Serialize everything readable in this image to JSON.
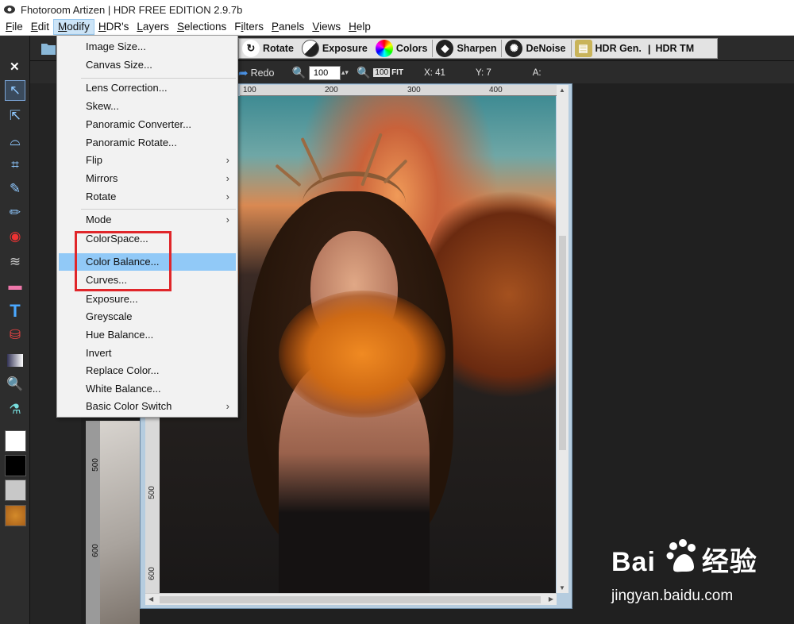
{
  "window": {
    "title": "Fhotoroom Artizen | HDR FREE EDITION 2.9.7b"
  },
  "menubar": {
    "items": [
      {
        "label": "File",
        "u": "F",
        "rest": "ile"
      },
      {
        "label": "Edit",
        "u": "E",
        "rest": "dit"
      },
      {
        "label": "Modify",
        "u": "M",
        "rest": "odify"
      },
      {
        "label": "HDR's",
        "u": "H",
        "rest": "DR's"
      },
      {
        "label": "Layers",
        "u": "L",
        "rest": "ayers"
      },
      {
        "label": "Selections",
        "u": "S",
        "rest": "elections"
      },
      {
        "label": "Filters",
        "u": "i",
        "pre": "F",
        "rest": "lters"
      },
      {
        "label": "Panels",
        "u": "P",
        "rest": "anels"
      },
      {
        "label": "Views",
        "u": "V",
        "rest": "iews"
      },
      {
        "label": "Help",
        "u": "H",
        "rest": "elp"
      }
    ]
  },
  "toolbar1": {
    "rotate": "Rotate",
    "exposure": "Exposure",
    "colors": "Colors",
    "sharpen": "Sharpen",
    "denoise": "DeNoise",
    "hdr_gen": "HDR Gen.",
    "separator": "|",
    "hdr_tm": "HDR TM"
  },
  "toolbar2": {
    "redo": "Redo",
    "zoom": "100",
    "zoom_glyph": "100",
    "fit": "FIT",
    "x": "X: 41",
    "y": "Y: 7",
    "a": "A:"
  },
  "ruler": {
    "h": [
      "100",
      "200",
      "300",
      "400"
    ],
    "v": [
      "500",
      "600"
    ],
    "outer_v": [
      "500",
      "600"
    ]
  },
  "modify_menu": {
    "items": [
      {
        "label": "Image Size...",
        "sub": false
      },
      {
        "label": "Canvas Size...",
        "sub": false
      },
      {
        "label": "Lens Correction...",
        "sub": false
      },
      {
        "label": "Skew...",
        "sub": false
      },
      {
        "label": "Panoramic Converter...",
        "sub": false
      },
      {
        "label": "Panoramic Rotate...",
        "sub": false
      },
      {
        "label": "Flip",
        "sub": true
      },
      {
        "label": "Mirrors",
        "sub": true
      },
      {
        "label": "Rotate",
        "sub": true
      },
      {
        "label": "Mode",
        "sub": true
      },
      {
        "label": "ColorSpace...",
        "sub": false
      },
      {
        "label": "Color Balance...",
        "sub": false,
        "highlighted": true
      },
      {
        "label": "Curves...",
        "sub": false
      },
      {
        "label": "Exposure...",
        "sub": false
      },
      {
        "label": "Greyscale",
        "sub": false
      },
      {
        "label": "Hue Balance...",
        "sub": false
      },
      {
        "label": "Invert",
        "sub": false
      },
      {
        "label": "Replace Color...",
        "sub": false
      },
      {
        "label": "White Balance...",
        "sub": false
      },
      {
        "label": "Basic Color Switch",
        "sub": true
      }
    ],
    "submenu_arrow": "›"
  },
  "watermark": {
    "brand": "Bai",
    "brand_end": "经验",
    "url": "jingyan.baidu.com"
  },
  "colors": {
    "highlight": "#91c9f7",
    "annotation": "#e0262a",
    "menu_active": "#cce4f7"
  }
}
